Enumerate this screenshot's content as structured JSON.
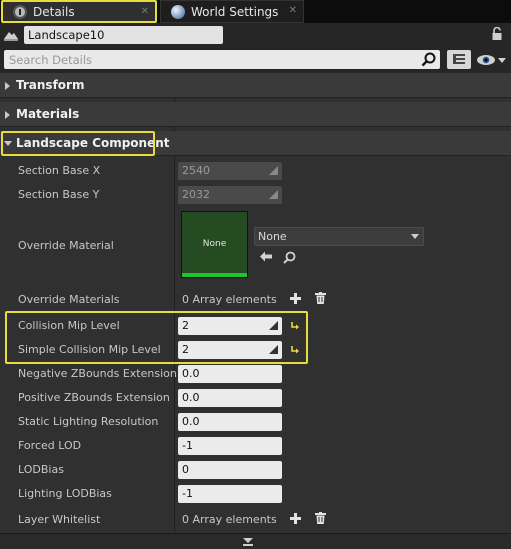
{
  "tabs": [
    {
      "label": "Details",
      "active": true
    },
    {
      "label": "World Settings",
      "active": false
    }
  ],
  "object": {
    "name": "Landscape10"
  },
  "search": {
    "placeholder": "Search Details"
  },
  "categories": {
    "transform": "Transform",
    "materials": "Materials",
    "landscape_component": "Landscape Component"
  },
  "props": {
    "section_base_x": {
      "label": "Section Base X",
      "value": "2540"
    },
    "section_base_y": {
      "label": "Section Base Y",
      "value": "2032"
    },
    "override_material": {
      "label": "Override Material",
      "thumb_text": "None",
      "combo_value": "None"
    },
    "override_materials": {
      "label": "Override Materials",
      "value": "0 Array elements"
    },
    "collision_mip_level": {
      "label": "Collision Mip Level",
      "value": "2"
    },
    "simple_collision_mip_level": {
      "label": "Simple Collision Mip Level",
      "value": "2"
    },
    "negative_zbounds": {
      "label": "Negative ZBounds Extension",
      "value": "0.0"
    },
    "positive_zbounds": {
      "label": "Positive ZBounds Extension",
      "value": "0.0"
    },
    "static_lighting_resolution": {
      "label": "Static Lighting Resolution",
      "value": "0.0"
    },
    "forced_lod": {
      "label": "Forced LOD",
      "value": "-1"
    },
    "lod_bias": {
      "label": "LODBias",
      "value": "0"
    },
    "lighting_lod_bias": {
      "label": "Lighting LODBias",
      "value": "-1"
    },
    "layer_whitelist": {
      "label": "Layer Whitelist",
      "value": "0 Array elements"
    }
  },
  "colors": {
    "highlight": "#e8dc3c",
    "thumb_bar": "#21c42e"
  }
}
